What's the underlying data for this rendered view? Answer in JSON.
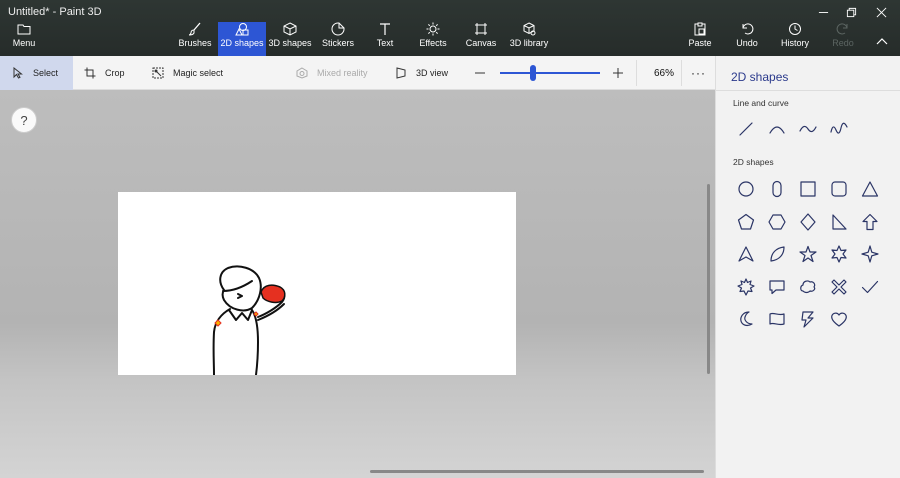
{
  "window": {
    "title": "Untitled* - Paint 3D"
  },
  "ribbon": {
    "menu_label": "Menu",
    "tools": [
      {
        "id": "brushes",
        "label": "Brushes",
        "icon": "brush-icon"
      },
      {
        "id": "2dshapes",
        "label": "2D shapes",
        "icon": "2d-shapes-icon",
        "active": true
      },
      {
        "id": "3dshapes",
        "label": "3D shapes",
        "icon": "3d-cube-icon"
      },
      {
        "id": "stickers",
        "label": "Stickers",
        "icon": "sticker-icon"
      },
      {
        "id": "text",
        "label": "Text",
        "icon": "text-icon"
      },
      {
        "id": "effects",
        "label": "Effects",
        "icon": "sun-icon"
      },
      {
        "id": "canvas",
        "label": "Canvas",
        "icon": "canvas-icon"
      },
      {
        "id": "3dlibrary",
        "label": "3D library",
        "icon": "3d-library-icon"
      }
    ],
    "actions": [
      {
        "id": "paste",
        "label": "Paste",
        "icon": "paste-icon"
      },
      {
        "id": "undo",
        "label": "Undo",
        "icon": "undo-icon"
      },
      {
        "id": "history",
        "label": "History",
        "icon": "history-icon"
      },
      {
        "id": "redo",
        "label": "Redo",
        "icon": "redo-icon",
        "disabled": true
      }
    ]
  },
  "toolbar": {
    "select_label": "Select",
    "crop_label": "Crop",
    "magic_select_label": "Magic select",
    "mixed_reality_label": "Mixed reality",
    "view3d_label": "3D view",
    "zoom_value": "66%",
    "zoom_fraction": 0.33,
    "more_label": "···"
  },
  "help": {
    "label": "?"
  },
  "panel": {
    "title": "2D shapes",
    "line_section_label": "Line and curve",
    "shapes_section_label": "2D shapes",
    "lines": [
      "line-icon",
      "curve-icon",
      "wave-curve-icon",
      "double-wave-curve-icon"
    ],
    "shapes": [
      "circle-icon",
      "pill-icon",
      "square-icon",
      "rounded-square-icon",
      "triangle-icon",
      "pentagon-icon",
      "hexagon-icon",
      "diamond-icon",
      "right-triangle-icon",
      "arrow-up-icon",
      "arrowhead-icon",
      "leaf-icon",
      "star5-icon",
      "star6-icon",
      "star4-icon",
      "burst-icon",
      "speech-bubble-icon",
      "thought-bubble-icon",
      "x-mark-icon",
      "checkmark-icon",
      "moon-icon",
      "banner-icon",
      "lightning-icon",
      "heart-icon"
    ]
  },
  "colors": {
    "accent": "#2d56d4",
    "panel_title": "#2b3a8c",
    "shape_stroke": "#2b3566",
    "drawing_red": "#e53020"
  }
}
